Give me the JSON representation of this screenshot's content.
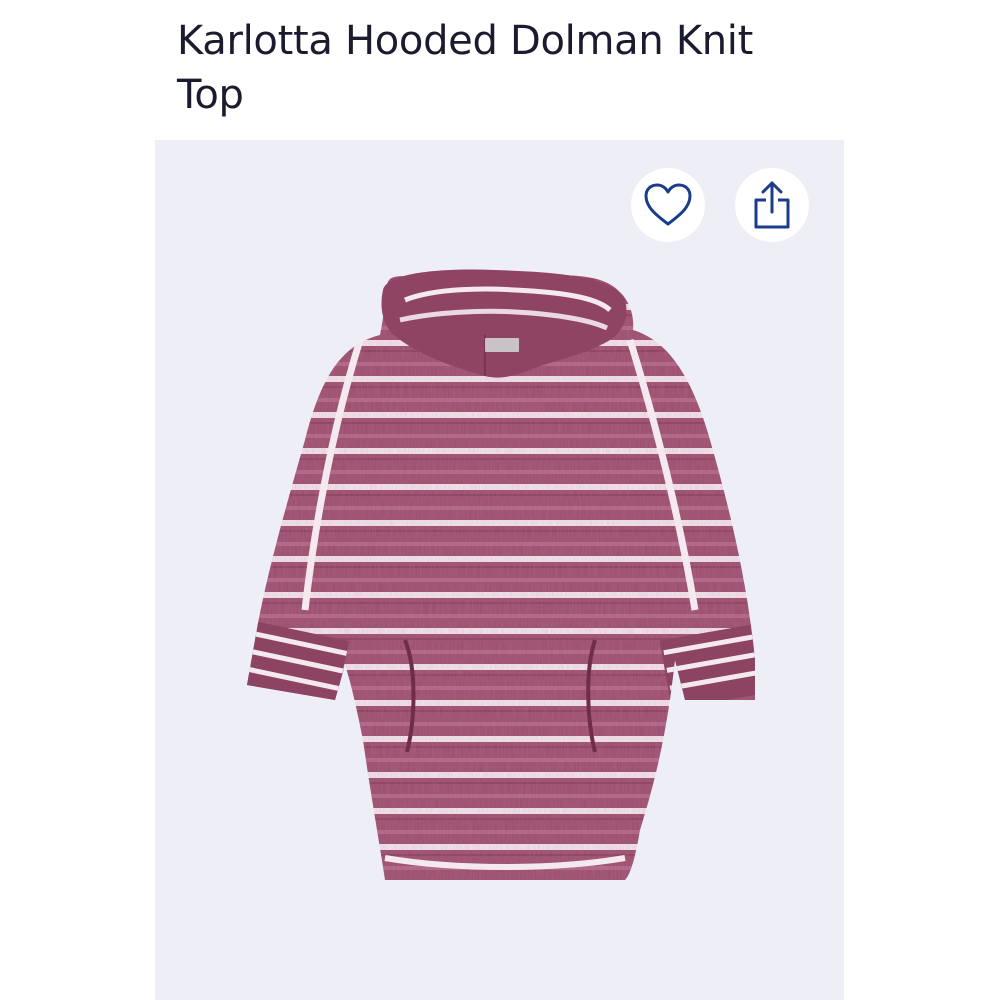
{
  "product": {
    "title": "Karlotta Hooded Dolman Knit Top",
    "image_alt": "Karlotta Hooded Dolman Knit Top"
  },
  "actions": {
    "favorite_icon": "heart-outline-icon",
    "share_icon": "share-icon"
  },
  "colors": {
    "title_text": "#1b1b2f",
    "image_background": "#eeeff6",
    "icon_color": "#1b3c8c",
    "garment_base": "#9a4d6b",
    "garment_stripe": "#f4e9ef"
  }
}
